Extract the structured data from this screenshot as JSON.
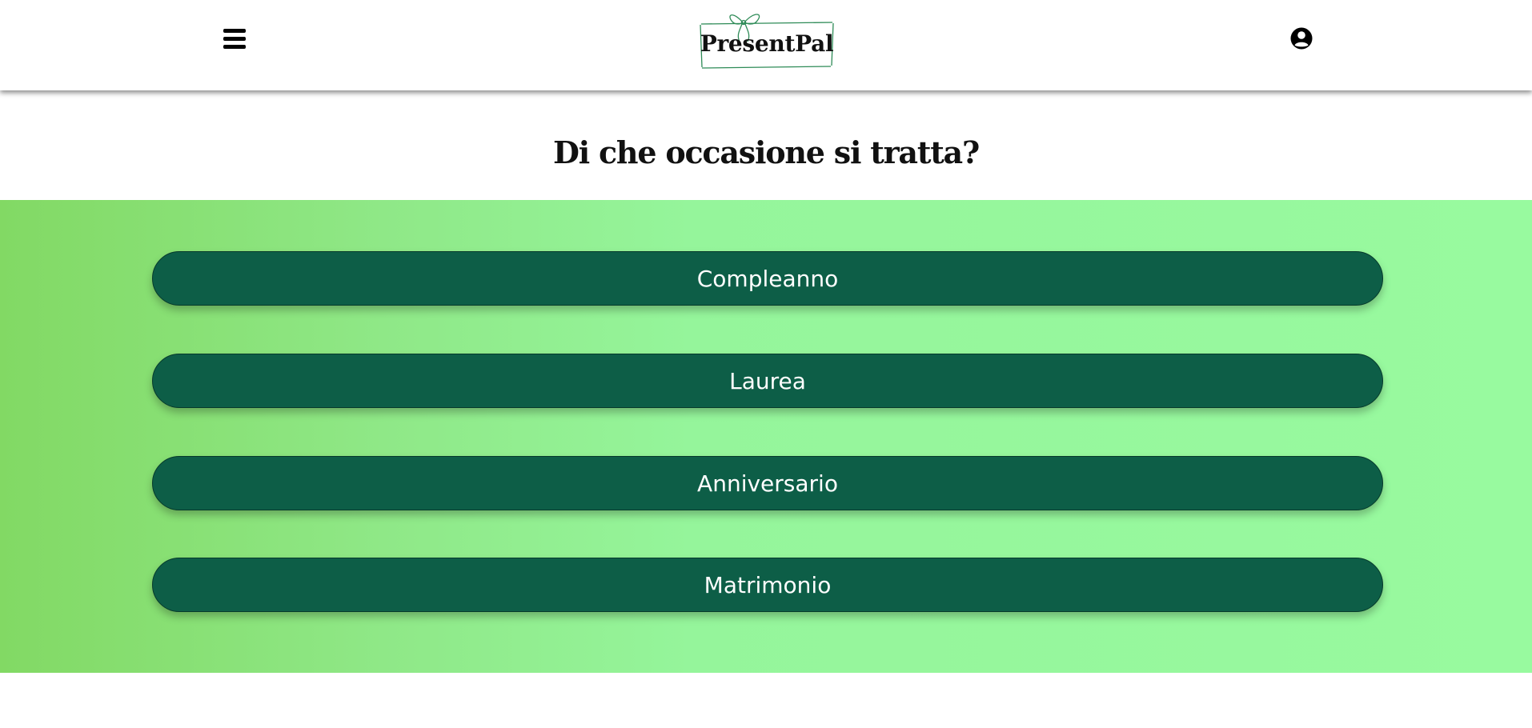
{
  "header": {
    "menu_icon": "hamburger-menu-icon",
    "logo_text": "PresentPal",
    "user_icon": "user-circle-icon"
  },
  "main": {
    "question": "Di che occasione si tratta?",
    "options": [
      {
        "label": "Compleanno"
      },
      {
        "label": "Laurea"
      },
      {
        "label": "Anniversario"
      },
      {
        "label": "Matrimonio"
      }
    ]
  },
  "colors": {
    "button_bg": "#0d5e47",
    "panel_gradient_start": "#82d964",
    "panel_gradient_end": "#98fa9f",
    "logo_accent": "#2e8b57"
  }
}
